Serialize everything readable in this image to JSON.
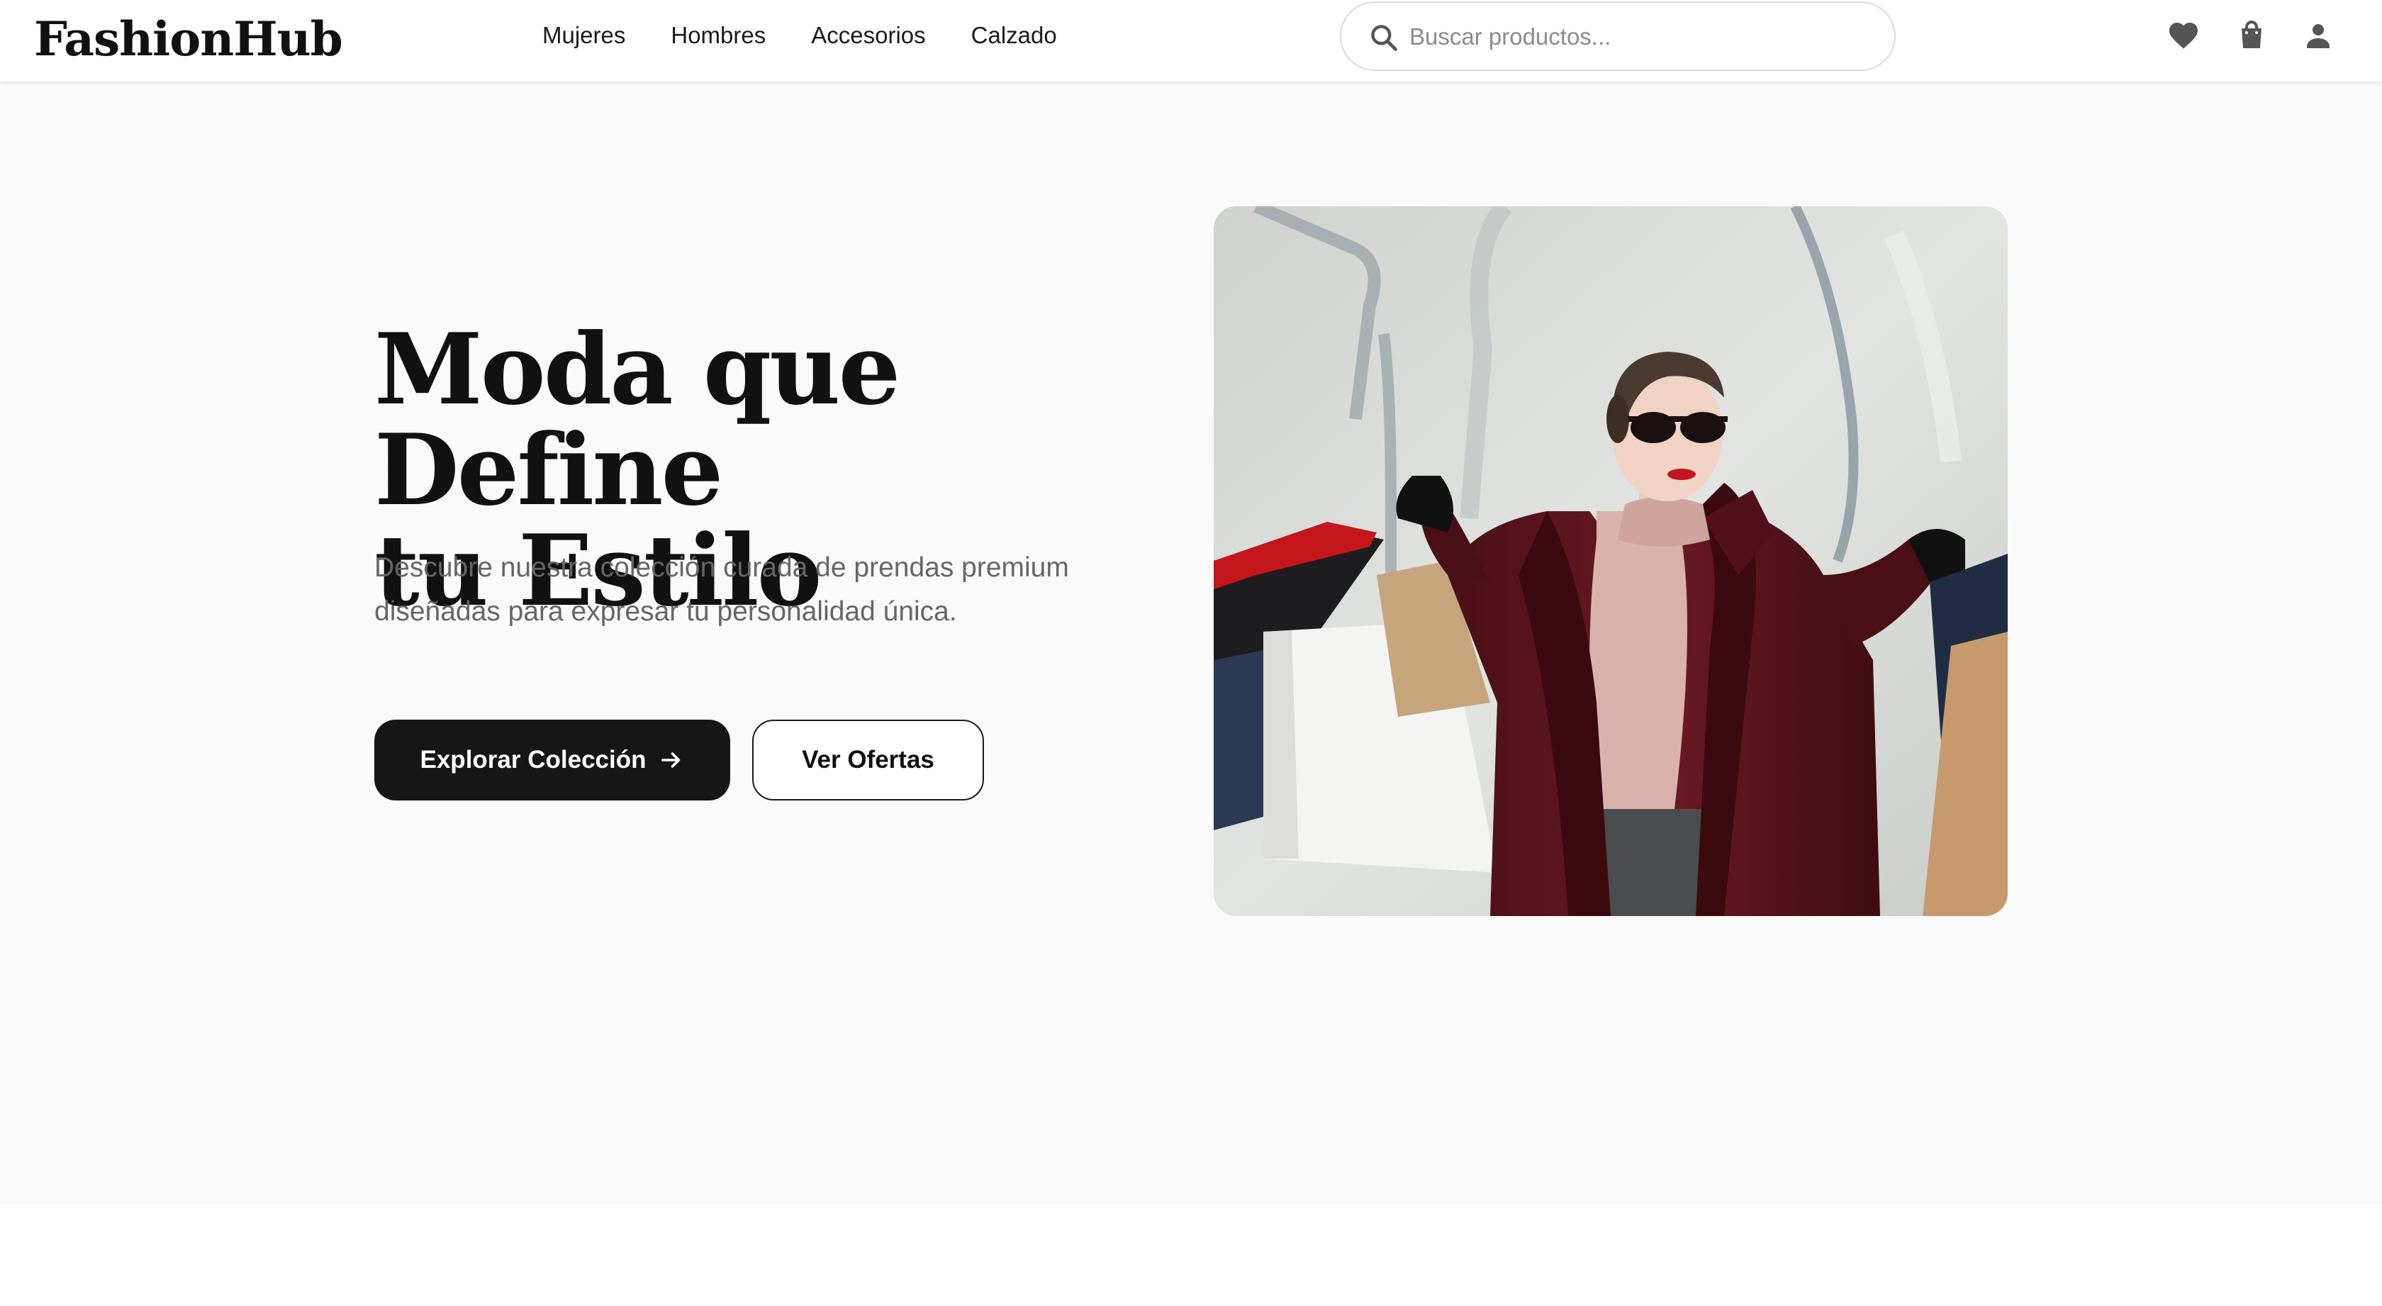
{
  "brand": {
    "logo": "FashionHub"
  },
  "nav": {
    "items": [
      {
        "label": "Mujeres"
      },
      {
        "label": "Hombres"
      },
      {
        "label": "Accesorios"
      },
      {
        "label": "Calzado"
      }
    ]
  },
  "search": {
    "placeholder": "Buscar productos..."
  },
  "header_icons": [
    "heart-icon",
    "shopping-bag-icon",
    "user-icon"
  ],
  "hero": {
    "title_line1": "Moda que Define",
    "title_line2": "tu Estilo",
    "subtitle": "Descubre nuestra colección curada de prendas premium diseñadas para expresar tu personalidad única.",
    "primary_button": "Explorar Colección",
    "secondary_button": "Ver Ofertas"
  },
  "colors": {
    "accent_dark": "#161616",
    "background": "#fafafa",
    "muted_text": "#666666"
  }
}
